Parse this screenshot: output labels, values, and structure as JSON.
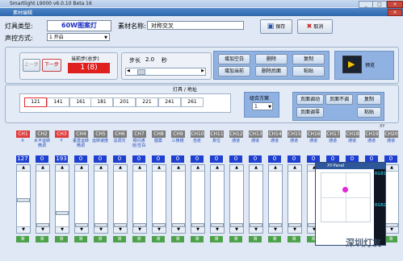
{
  "window": {
    "outer_title": "Smartlight L9000  v6.0.10 Beta 16",
    "inner_title": "素材编辑"
  },
  "header": {
    "lamp_type_label": "灯具类型:",
    "lamp_type_value": "60W图案灯",
    "control_mode_label": "声控方式:",
    "control_mode_value": "1 开启",
    "material_name_label": "素材名称:",
    "material_name_value": "对称交叉",
    "save_label": "保存",
    "cancel_label": "取消"
  },
  "steps": {
    "prev_label": "上一步",
    "next_label": "下一步",
    "current_label": "当前步(总步)",
    "current_value": "1 (8)",
    "step_length_label": "步长",
    "step_length_value": "2.0",
    "step_length_unit": "秒"
  },
  "edit_buttons": [
    "增加空白",
    "删除",
    "复制",
    "增加当前",
    "删除后面",
    "粘贴"
  ],
  "preview_label": "预览",
  "points": {
    "title": "灯具 / 地址",
    "values": [
      "121",
      "141",
      "161",
      "181",
      "201",
      "221",
      "241",
      "261"
    ],
    "combo_label": "组合方案",
    "combo_value": "1",
    "page_buttons": [
      "页面调动",
      "页面不调",
      "复制",
      "页面调零",
      "粘贴"
    ]
  },
  "xy_label": "XY",
  "channels": [
    {
      "id": "CH1",
      "name": "X",
      "value": "127",
      "color": "#e03a3a"
    },
    {
      "id": "CH2",
      "name": "水平运转微调",
      "value": "0",
      "color": "#7d7d7d"
    },
    {
      "id": "CH3",
      "name": "Y",
      "value": "193",
      "color": "#e03a3a"
    },
    {
      "id": "CH4",
      "name": "垂直运转微调",
      "value": "0",
      "color": "#7d7d7d"
    },
    {
      "id": "CH5",
      "name": "运转速度",
      "value": "0",
      "color": "#7d7d7d"
    },
    {
      "id": "CH6",
      "name": "总调光",
      "value": "0",
      "color": "#7d7d7d"
    },
    {
      "id": "CH7",
      "name": "频闪通道/空白",
      "value": "0",
      "color": "#7d7d7d"
    },
    {
      "id": "CH8",
      "name": "图案",
      "value": "0",
      "color": "#7d7d7d"
    },
    {
      "id": "CH9",
      "name": "三棱镜",
      "value": "0",
      "color": "#7d7d7d"
    },
    {
      "id": "CH10",
      "name": "自走",
      "value": "0",
      "color": "#7d7d7d"
    },
    {
      "id": "CH11",
      "name": "复位",
      "value": "0",
      "color": "#7d7d7d"
    },
    {
      "id": "CH12",
      "name": "通道",
      "value": "0",
      "color": "#7d7d7d"
    },
    {
      "id": "CH13",
      "name": "通道",
      "value": "0",
      "color": "#7d7d7d"
    },
    {
      "id": "CH14",
      "name": "通道",
      "value": "0",
      "color": "#7d7d7d"
    },
    {
      "id": "CH15",
      "name": "通道",
      "value": "0",
      "color": "#7d7d7d"
    },
    {
      "id": "CH16",
      "name": "通道",
      "value": "0",
      "color": "#7d7d7d"
    },
    {
      "id": "CH17",
      "name": "通道",
      "value": "0",
      "color": "#7d7d7d"
    },
    {
      "id": "CH18",
      "name": "通道",
      "value": "0",
      "color": "#7d7d7d"
    },
    {
      "id": "CH19",
      "name": "通道",
      "value": "0",
      "color": "#7d7d7d"
    },
    {
      "id": "CH20",
      "name": "通道",
      "value": "0",
      "color": "#7d7d7d"
    }
  ],
  "channel_slider_levels": [
    0.5,
    0,
    0.24,
    0,
    0,
    0,
    0,
    0,
    0,
    0,
    0,
    0,
    0,
    0,
    0,
    0,
    0,
    0,
    0,
    0
  ],
  "slide_label": "滑",
  "xy_panel": {
    "title": "XY-Panel",
    "rgb1": "RGB1",
    "rgb2": "RGB2"
  },
  "watermark": "深圳灯友"
}
